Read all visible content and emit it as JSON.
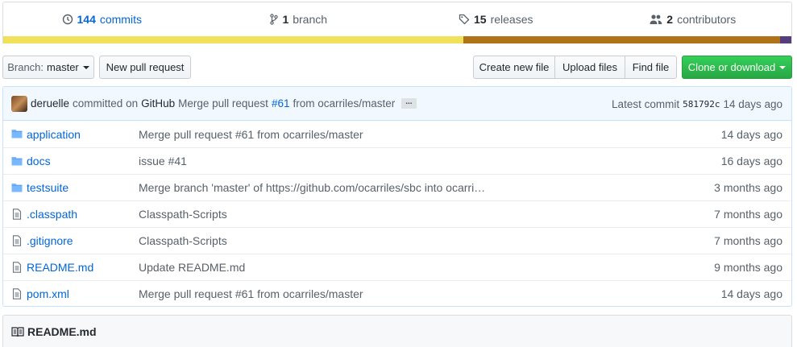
{
  "summary": {
    "commits": {
      "count": "144",
      "label": "commits",
      "icon": "history-icon"
    },
    "branches": {
      "count": "1",
      "label": "branch",
      "icon": "branch-icon"
    },
    "releases": {
      "count": "15",
      "label": "releases",
      "icon": "tag-icon"
    },
    "contributors": {
      "count": "2",
      "label": "contributors",
      "icon": "people-icon"
    }
  },
  "language_bar": {
    "segments": [
      {
        "share": 0.584,
        "color": "#f1e05a"
      },
      {
        "share": 0.402,
        "color": "#b07219"
      },
      {
        "share": 0.014,
        "color": "#563d7c"
      }
    ]
  },
  "toolbar": {
    "branch_prefix": "Branch:",
    "branch_name": "master",
    "new_pull_request": "New pull request",
    "create_new_file": "Create new file",
    "upload_files": "Upload files",
    "find_file": "Find file",
    "clone_or_download": "Clone or download"
  },
  "commit_tease": {
    "author": "deruelle",
    "action": "committed on",
    "committer": "GitHub",
    "message_prefix": "Merge pull request",
    "pr_number": "#61",
    "message_suffix": "from ocarriles/master",
    "ellipsis": "...",
    "latest_label": "Latest commit",
    "sha": "581792c",
    "age": "14 days ago"
  },
  "files": [
    {
      "type": "dir",
      "name": "application",
      "message": "Merge pull request #61 from ocarriles/master",
      "age": "14 days ago"
    },
    {
      "type": "dir",
      "name": "docs",
      "message": "issue #41",
      "age": "16 days ago"
    },
    {
      "type": "dir",
      "name": "testsuite",
      "message": "Merge branch 'master' of https://github.com/ocarriles/sbc into ocarri…",
      "age": "3 months ago"
    },
    {
      "type": "file",
      "name": ".classpath",
      "message": "Classpath-Scripts",
      "age": "7 months ago"
    },
    {
      "type": "file",
      "name": ".gitignore",
      "message": "Classpath-Scripts",
      "age": "7 months ago"
    },
    {
      "type": "file",
      "name": "README.md",
      "message": "Update README.md",
      "age": "9 months ago"
    },
    {
      "type": "file",
      "name": "pom.xml",
      "message": "Merge pull request #61 from ocarriles/master",
      "age": "14 days ago"
    }
  ],
  "readme": {
    "title": "README.md",
    "icon": "book-icon"
  }
}
